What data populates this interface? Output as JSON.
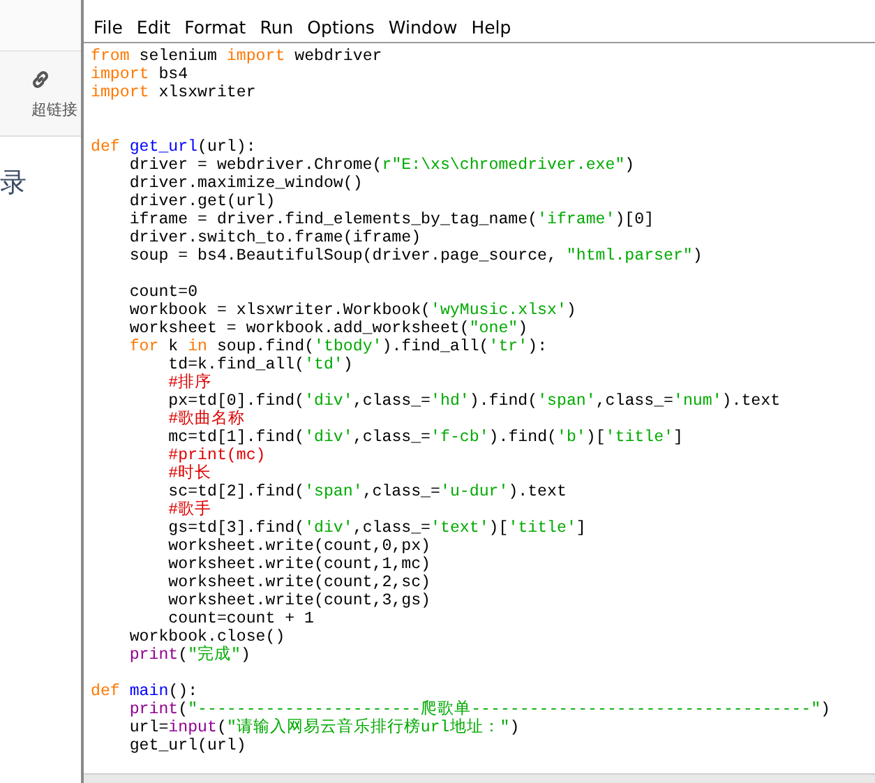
{
  "background_page": {
    "toolbar_label": "超链接",
    "heading_fragment": "录"
  },
  "editor": {
    "menu": [
      "File",
      "Edit",
      "Format",
      "Run",
      "Options",
      "Window",
      "Help"
    ],
    "lines": [
      {
        "kind": "code",
        "tokens": [
          {
            "kind": "keyword",
            "text": "from"
          },
          {
            "kind": "plain",
            "text": " selenium "
          },
          {
            "kind": "keyword",
            "text": "import"
          },
          {
            "kind": "plain",
            "text": " webdriver"
          }
        ]
      },
      {
        "kind": "code",
        "tokens": [
          {
            "kind": "keyword",
            "text": "import"
          },
          {
            "kind": "plain",
            "text": " bs4"
          }
        ]
      },
      {
        "kind": "code",
        "tokens": [
          {
            "kind": "keyword",
            "text": "import"
          },
          {
            "kind": "plain",
            "text": " xlsxwriter"
          }
        ]
      },
      {
        "kind": "blank"
      },
      {
        "kind": "blank"
      },
      {
        "kind": "code",
        "tokens": [
          {
            "kind": "keyword",
            "text": "def "
          },
          {
            "kind": "definition",
            "text": "get_url"
          },
          {
            "kind": "plain",
            "text": "(url):"
          }
        ]
      },
      {
        "kind": "code",
        "tokens": [
          {
            "kind": "plain",
            "text": "    driver = webdriver.Chrome("
          },
          {
            "kind": "string",
            "text": "r\"E:\\xs\\chromedriver.exe\""
          },
          {
            "kind": "plain",
            "text": ")"
          }
        ]
      },
      {
        "kind": "code",
        "tokens": [
          {
            "kind": "plain",
            "text": "    driver.maximize_window()"
          }
        ]
      },
      {
        "kind": "code",
        "tokens": [
          {
            "kind": "plain",
            "text": "    driver.get(url)"
          }
        ]
      },
      {
        "kind": "code",
        "tokens": [
          {
            "kind": "plain",
            "text": "    iframe = driver.find_elements_by_tag_name("
          },
          {
            "kind": "string",
            "text": "'iframe'"
          },
          {
            "kind": "plain",
            "text": ")[0]"
          }
        ]
      },
      {
        "kind": "code",
        "tokens": [
          {
            "kind": "plain",
            "text": "    driver.switch_to.frame(iframe)"
          }
        ]
      },
      {
        "kind": "code",
        "tokens": [
          {
            "kind": "plain",
            "text": "    soup = bs4.BeautifulSoup(driver.page_source, "
          },
          {
            "kind": "string",
            "text": "\"html.parser\""
          },
          {
            "kind": "plain",
            "text": ")"
          }
        ]
      },
      {
        "kind": "blank"
      },
      {
        "kind": "code",
        "tokens": [
          {
            "kind": "plain",
            "text": "    count=0"
          }
        ]
      },
      {
        "kind": "code",
        "tokens": [
          {
            "kind": "plain",
            "text": "    workbook = xlsxwriter.Workbook("
          },
          {
            "kind": "string",
            "text": "'wyMusic.xlsx'"
          },
          {
            "kind": "plain",
            "text": ")"
          }
        ]
      },
      {
        "kind": "code",
        "tokens": [
          {
            "kind": "plain",
            "text": "    worksheet = workbook.add_worksheet("
          },
          {
            "kind": "string",
            "text": "\"one\""
          },
          {
            "kind": "plain",
            "text": ")"
          }
        ]
      },
      {
        "kind": "code",
        "tokens": [
          {
            "kind": "keyword",
            "text": "    for"
          },
          {
            "kind": "plain",
            "text": " k "
          },
          {
            "kind": "keyword",
            "text": "in"
          },
          {
            "kind": "plain",
            "text": " soup.find("
          },
          {
            "kind": "string",
            "text": "'tbody'"
          },
          {
            "kind": "plain",
            "text": ").find_all("
          },
          {
            "kind": "string",
            "text": "'tr'"
          },
          {
            "kind": "plain",
            "text": "):"
          }
        ]
      },
      {
        "kind": "code",
        "tokens": [
          {
            "kind": "plain",
            "text": "        td=k.find_all("
          },
          {
            "kind": "string",
            "text": "'td'"
          },
          {
            "kind": "plain",
            "text": ")"
          }
        ]
      },
      {
        "kind": "code",
        "tokens": [
          {
            "kind": "comment",
            "text": "        #排序"
          }
        ]
      },
      {
        "kind": "code",
        "tokens": [
          {
            "kind": "plain",
            "text": "        px=td[0].find("
          },
          {
            "kind": "string",
            "text": "'div'"
          },
          {
            "kind": "plain",
            "text": ",class_="
          },
          {
            "kind": "string",
            "text": "'hd'"
          },
          {
            "kind": "plain",
            "text": ").find("
          },
          {
            "kind": "string",
            "text": "'span'"
          },
          {
            "kind": "plain",
            "text": ",class_="
          },
          {
            "kind": "string",
            "text": "'num'"
          },
          {
            "kind": "plain",
            "text": ").text"
          }
        ]
      },
      {
        "kind": "code",
        "tokens": [
          {
            "kind": "comment",
            "text": "        #歌曲名称"
          }
        ]
      },
      {
        "kind": "code",
        "tokens": [
          {
            "kind": "plain",
            "text": "        mc=td[1].find("
          },
          {
            "kind": "string",
            "text": "'div'"
          },
          {
            "kind": "plain",
            "text": ",class_="
          },
          {
            "kind": "string",
            "text": "'f-cb'"
          },
          {
            "kind": "plain",
            "text": ").find("
          },
          {
            "kind": "string",
            "text": "'b'"
          },
          {
            "kind": "plain",
            "text": ")["
          },
          {
            "kind": "string",
            "text": "'title'"
          },
          {
            "kind": "plain",
            "text": "]"
          }
        ]
      },
      {
        "kind": "code",
        "tokens": [
          {
            "kind": "comment",
            "text": "        #print(mc)"
          }
        ]
      },
      {
        "kind": "code",
        "tokens": [
          {
            "kind": "comment",
            "text": "        #时长"
          }
        ]
      },
      {
        "kind": "code",
        "tokens": [
          {
            "kind": "plain",
            "text": "        sc=td[2].find("
          },
          {
            "kind": "string",
            "text": "'span'"
          },
          {
            "kind": "plain",
            "text": ",class_="
          },
          {
            "kind": "string",
            "text": "'u-dur'"
          },
          {
            "kind": "plain",
            "text": ").text"
          }
        ]
      },
      {
        "kind": "code",
        "tokens": [
          {
            "kind": "comment",
            "text": "        #歌手"
          }
        ]
      },
      {
        "kind": "code",
        "tokens": [
          {
            "kind": "plain",
            "text": "        gs=td[3].find("
          },
          {
            "kind": "string",
            "text": "'div'"
          },
          {
            "kind": "plain",
            "text": ",class_="
          },
          {
            "kind": "string",
            "text": "'text'"
          },
          {
            "kind": "plain",
            "text": ")["
          },
          {
            "kind": "string",
            "text": "'title'"
          },
          {
            "kind": "plain",
            "text": "]"
          }
        ]
      },
      {
        "kind": "code",
        "tokens": [
          {
            "kind": "plain",
            "text": "        worksheet.write(count,0,px)"
          }
        ]
      },
      {
        "kind": "code",
        "tokens": [
          {
            "kind": "plain",
            "text": "        worksheet.write(count,1,mc)"
          }
        ]
      },
      {
        "kind": "code",
        "tokens": [
          {
            "kind": "plain",
            "text": "        worksheet.write(count,2,sc)"
          }
        ]
      },
      {
        "kind": "code",
        "tokens": [
          {
            "kind": "plain",
            "text": "        worksheet.write(count,3,gs)"
          }
        ]
      },
      {
        "kind": "code",
        "tokens": [
          {
            "kind": "plain",
            "text": "        count=count + 1"
          }
        ]
      },
      {
        "kind": "code",
        "tokens": [
          {
            "kind": "plain",
            "text": "    workbook.close()"
          }
        ]
      },
      {
        "kind": "code",
        "tokens": [
          {
            "kind": "builtin",
            "text": "    print"
          },
          {
            "kind": "plain",
            "text": "("
          },
          {
            "kind": "string",
            "text": "\"完成\""
          },
          {
            "kind": "plain",
            "text": ")"
          }
        ]
      },
      {
        "kind": "blank"
      },
      {
        "kind": "code",
        "tokens": [
          {
            "kind": "keyword",
            "text": "def "
          },
          {
            "kind": "definition",
            "text": "main"
          },
          {
            "kind": "plain",
            "text": "():"
          }
        ]
      },
      {
        "kind": "code",
        "tokens": [
          {
            "kind": "builtin",
            "text": "    print"
          },
          {
            "kind": "plain",
            "text": "("
          },
          {
            "kind": "string",
            "text": "\"-----------------------爬歌单-----------------------------------\""
          },
          {
            "kind": "plain",
            "text": ")"
          }
        ]
      },
      {
        "kind": "code",
        "tokens": [
          {
            "kind": "plain",
            "text": "    url="
          },
          {
            "kind": "builtin",
            "text": "input"
          },
          {
            "kind": "plain",
            "text": "("
          },
          {
            "kind": "string",
            "text": "\"请输入网易云音乐排行榜url地址：\""
          },
          {
            "kind": "plain",
            "text": ")"
          }
        ]
      },
      {
        "kind": "code",
        "tokens": [
          {
            "kind": "plain",
            "text": "    get_url(url)"
          }
        ]
      }
    ]
  }
}
